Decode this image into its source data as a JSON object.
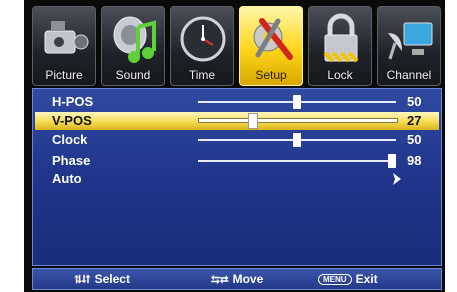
{
  "tabs": [
    {
      "label": "Picture",
      "icon": "camcorder-icon",
      "active": false
    },
    {
      "label": "Sound",
      "icon": "music-note-icon",
      "active": false
    },
    {
      "label": "Time",
      "icon": "clock-icon",
      "active": false
    },
    {
      "label": "Setup",
      "icon": "tools-icon",
      "active": true
    },
    {
      "label": "Lock",
      "icon": "padlock-icon",
      "active": false
    },
    {
      "label": "Channel",
      "icon": "satellite-dish-icon",
      "active": false
    }
  ],
  "menu": {
    "selected": "V-POS",
    "items": [
      {
        "label": "H-POS",
        "value": "50",
        "level": 0.5
      },
      {
        "label": "V-POS",
        "value": "27",
        "level": 0.27
      },
      {
        "label": "Clock",
        "value": "50",
        "level": 0.5
      },
      {
        "label": "Phase",
        "value": "98",
        "level": 0.98
      },
      {
        "label": "Auto",
        "value": "›"
      }
    ]
  },
  "help": {
    "select_symbol": "⮁⮃",
    "select_label": "Select",
    "move_symbol": "⮀⮂",
    "move_label": "Move",
    "menu_key": "MENU",
    "exit_label": "Exit"
  },
  "colors": {
    "accent": "#f3d84a",
    "panel": "#20358a",
    "frame": "#0a0a0a"
  }
}
